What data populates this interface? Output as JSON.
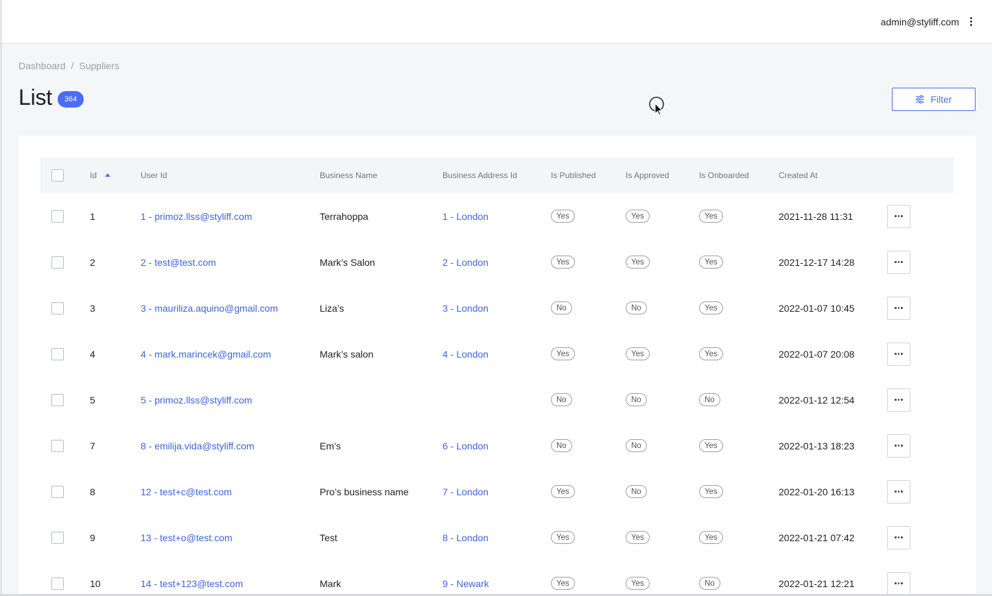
{
  "topbar": {
    "user_email": "admin@styliff.com"
  },
  "breadcrumb": {
    "items": [
      "Dashboard",
      "Suppliers"
    ],
    "separator": "/"
  },
  "page": {
    "title": "List",
    "count": "364"
  },
  "filter": {
    "label": "Filter"
  },
  "table": {
    "headers": [
      "Id",
      "User Id",
      "Business Name",
      "Business Address Id",
      "Is Published",
      "Is Approved",
      "Is Onboarded",
      "Created At"
    ],
    "rows": [
      {
        "id": "1",
        "user": "1 - primoz.llss@styliff.com",
        "business": "Terrahoppa",
        "address": "1 - London",
        "published": "Yes",
        "approved": "Yes",
        "onboarded": "Yes",
        "created": "2021-11-28 11:31"
      },
      {
        "id": "2",
        "user": "2 - test@test.com",
        "business": "Mark’s Salon",
        "address": "2 - London",
        "published": "Yes",
        "approved": "Yes",
        "onboarded": "Yes",
        "created": "2021-12-17 14:28"
      },
      {
        "id": "3",
        "user": "3 - mauriliza.aquino@gmail.com",
        "business": "Liza’s",
        "address": "3 - London",
        "published": "No",
        "approved": "No",
        "onboarded": "Yes",
        "created": "2022-01-07 10:45"
      },
      {
        "id": "4",
        "user": "4 - mark.marincek@gmail.com",
        "business": "Mark’s salon",
        "address": "4 - London",
        "published": "Yes",
        "approved": "Yes",
        "onboarded": "Yes",
        "created": "2022-01-07 20:08"
      },
      {
        "id": "5",
        "user": "5 - primoz.llss@styliff.com",
        "business": "",
        "address": "",
        "published": "No",
        "approved": "No",
        "onboarded": "No",
        "created": "2022-01-12 12:54"
      },
      {
        "id": "7",
        "user": "8 - emilija.vida@styliff.com",
        "business": "Em’s",
        "address": "6 - London",
        "published": "No",
        "approved": "No",
        "onboarded": "Yes",
        "created": "2022-01-13 18:23"
      },
      {
        "id": "8",
        "user": "12 - test+c@test.com",
        "business": "Pro’s business name",
        "address": "7 - London",
        "published": "Yes",
        "approved": "No",
        "onboarded": "Yes",
        "created": "2022-01-20 16:13"
      },
      {
        "id": "9",
        "user": "13 - test+o@test.com",
        "business": "Test",
        "address": "8 - London",
        "published": "Yes",
        "approved": "Yes",
        "onboarded": "Yes",
        "created": "2022-01-21 07:42"
      },
      {
        "id": "10",
        "user": "14 - test+123@test.com",
        "business": "Mark",
        "address": "9 - Newark",
        "published": "Yes",
        "approved": "Yes",
        "onboarded": "No",
        "created": "2022-01-21 12:21"
      }
    ]
  },
  "colors": {
    "accent": "#4a6cf7",
    "link": "#3d63e0",
    "background": "#f5f6f8"
  }
}
